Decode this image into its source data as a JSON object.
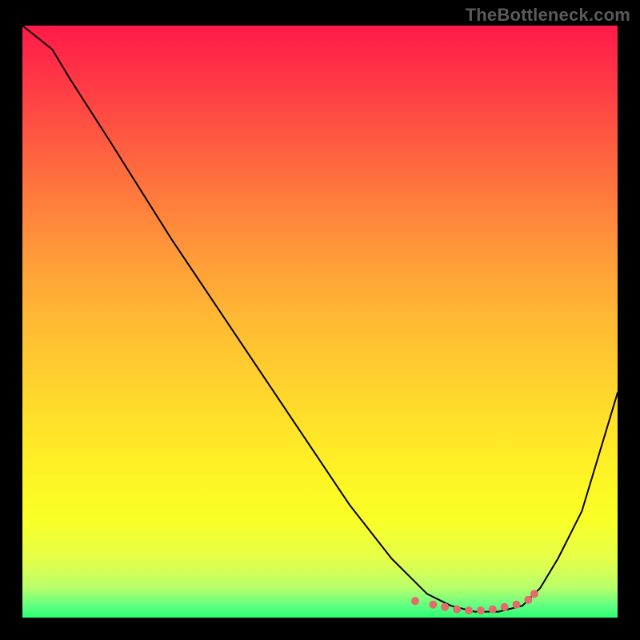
{
  "watermark": "TheBottleneck.com",
  "chart_data": {
    "type": "line",
    "title": "",
    "xlabel": "",
    "ylabel": "",
    "xlim": [
      0,
      1
    ],
    "ylim": [
      0,
      1
    ],
    "grid": false,
    "legend": false,
    "series": [
      {
        "name": "bottleneck-curve",
        "x": [
          0.0,
          0.05,
          0.08,
          0.15,
          0.25,
          0.35,
          0.45,
          0.55,
          0.62,
          0.68,
          0.72,
          0.76,
          0.8,
          0.84,
          0.87,
          0.9,
          0.94,
          0.97,
          1.0
        ],
        "y": [
          1.0,
          0.96,
          0.91,
          0.8,
          0.64,
          0.49,
          0.34,
          0.19,
          0.1,
          0.04,
          0.02,
          0.01,
          0.01,
          0.02,
          0.05,
          0.1,
          0.18,
          0.28,
          0.38
        ]
      }
    ],
    "trough_markers": {
      "name": "optimal-range-dots",
      "color": "#e46a6c",
      "points": [
        {
          "x": 0.66,
          "y": 0.028
        },
        {
          "x": 0.69,
          "y": 0.022
        },
        {
          "x": 0.71,
          "y": 0.018
        },
        {
          "x": 0.73,
          "y": 0.014
        },
        {
          "x": 0.75,
          "y": 0.012
        },
        {
          "x": 0.77,
          "y": 0.012
        },
        {
          "x": 0.79,
          "y": 0.014
        },
        {
          "x": 0.81,
          "y": 0.018
        },
        {
          "x": 0.83,
          "y": 0.022
        },
        {
          "x": 0.85,
          "y": 0.03
        },
        {
          "x": 0.86,
          "y": 0.04
        }
      ]
    },
    "background": {
      "type": "vertical-gradient",
      "stops": [
        {
          "pos": 0.0,
          "color": "#ff1a49"
        },
        {
          "pos": 0.5,
          "color": "#ffba33"
        },
        {
          "pos": 0.83,
          "color": "#faff25"
        },
        {
          "pos": 1.0,
          "color": "#2bff74"
        }
      ]
    }
  }
}
